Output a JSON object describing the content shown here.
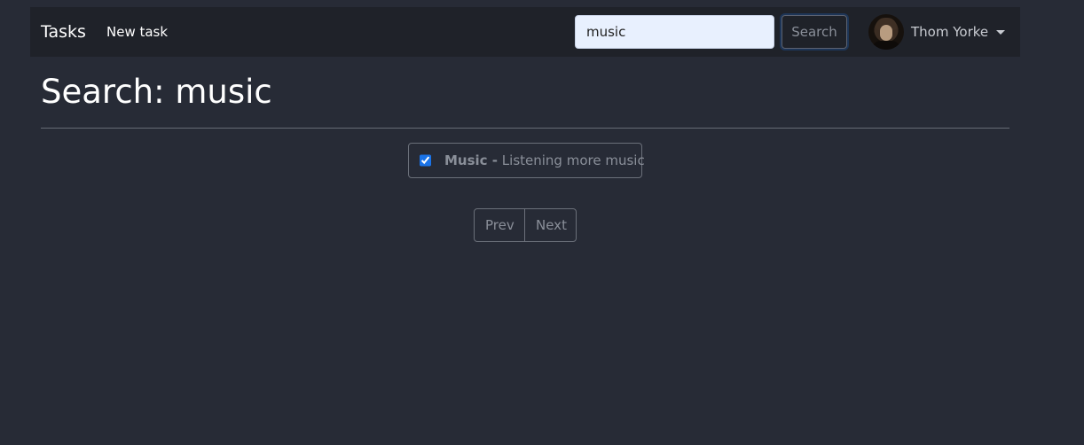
{
  "navbar": {
    "brand": "Tasks",
    "new_task_label": "New task",
    "search": {
      "value": "music",
      "button_label": "Search"
    },
    "user": {
      "name": "Thom Yorke"
    }
  },
  "page": {
    "title": "Search: music"
  },
  "results": [
    {
      "title": "Music -",
      "description": "Listening more music",
      "checked": true
    }
  ],
  "pagination": {
    "prev_label": "Prev",
    "next_label": "Next"
  },
  "colors": {
    "background": "#272b36",
    "navbar": "#1f2229",
    "input_bg": "#e8f0fe",
    "checkbox_accent": "#1a73e8"
  },
  "icons": {
    "user_menu_caret": "caret-down-icon"
  }
}
